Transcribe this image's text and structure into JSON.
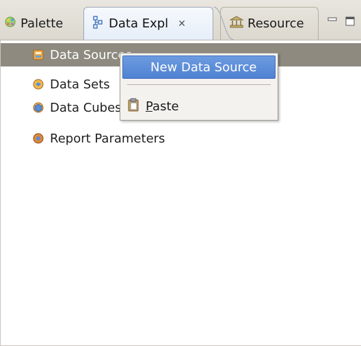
{
  "tabs": [
    {
      "label": "Palette",
      "icon": "palette-icon"
    },
    {
      "label": "Data Expl",
      "icon": "data-explorer-icon",
      "close_glyph": "✕"
    },
    {
      "label": "Resource",
      "icon": "resource-icon"
    }
  ],
  "view_controls": {
    "minimize": "minimize",
    "maximize": "maximize"
  },
  "tree": {
    "items": [
      {
        "label": "Data Sources",
        "icon": "data-sources-icon",
        "selected": true
      },
      {
        "label": "Data Sets",
        "icon": "data-sets-icon",
        "selected": false
      },
      {
        "label": "Data Cubes",
        "icon": "data-cubes-icon",
        "selected": false
      },
      {
        "label": "Report Parameters",
        "icon": "report-parameters-icon",
        "selected": false
      }
    ]
  },
  "context_menu": {
    "new_data_source": "New Data Source",
    "paste_mnemonic": "P",
    "paste_rest": "aste"
  },
  "colors": {
    "selection": "#8e8a80",
    "menu_highlight": "#5a8cd8",
    "tab_active_border": "#9aa6b6"
  }
}
